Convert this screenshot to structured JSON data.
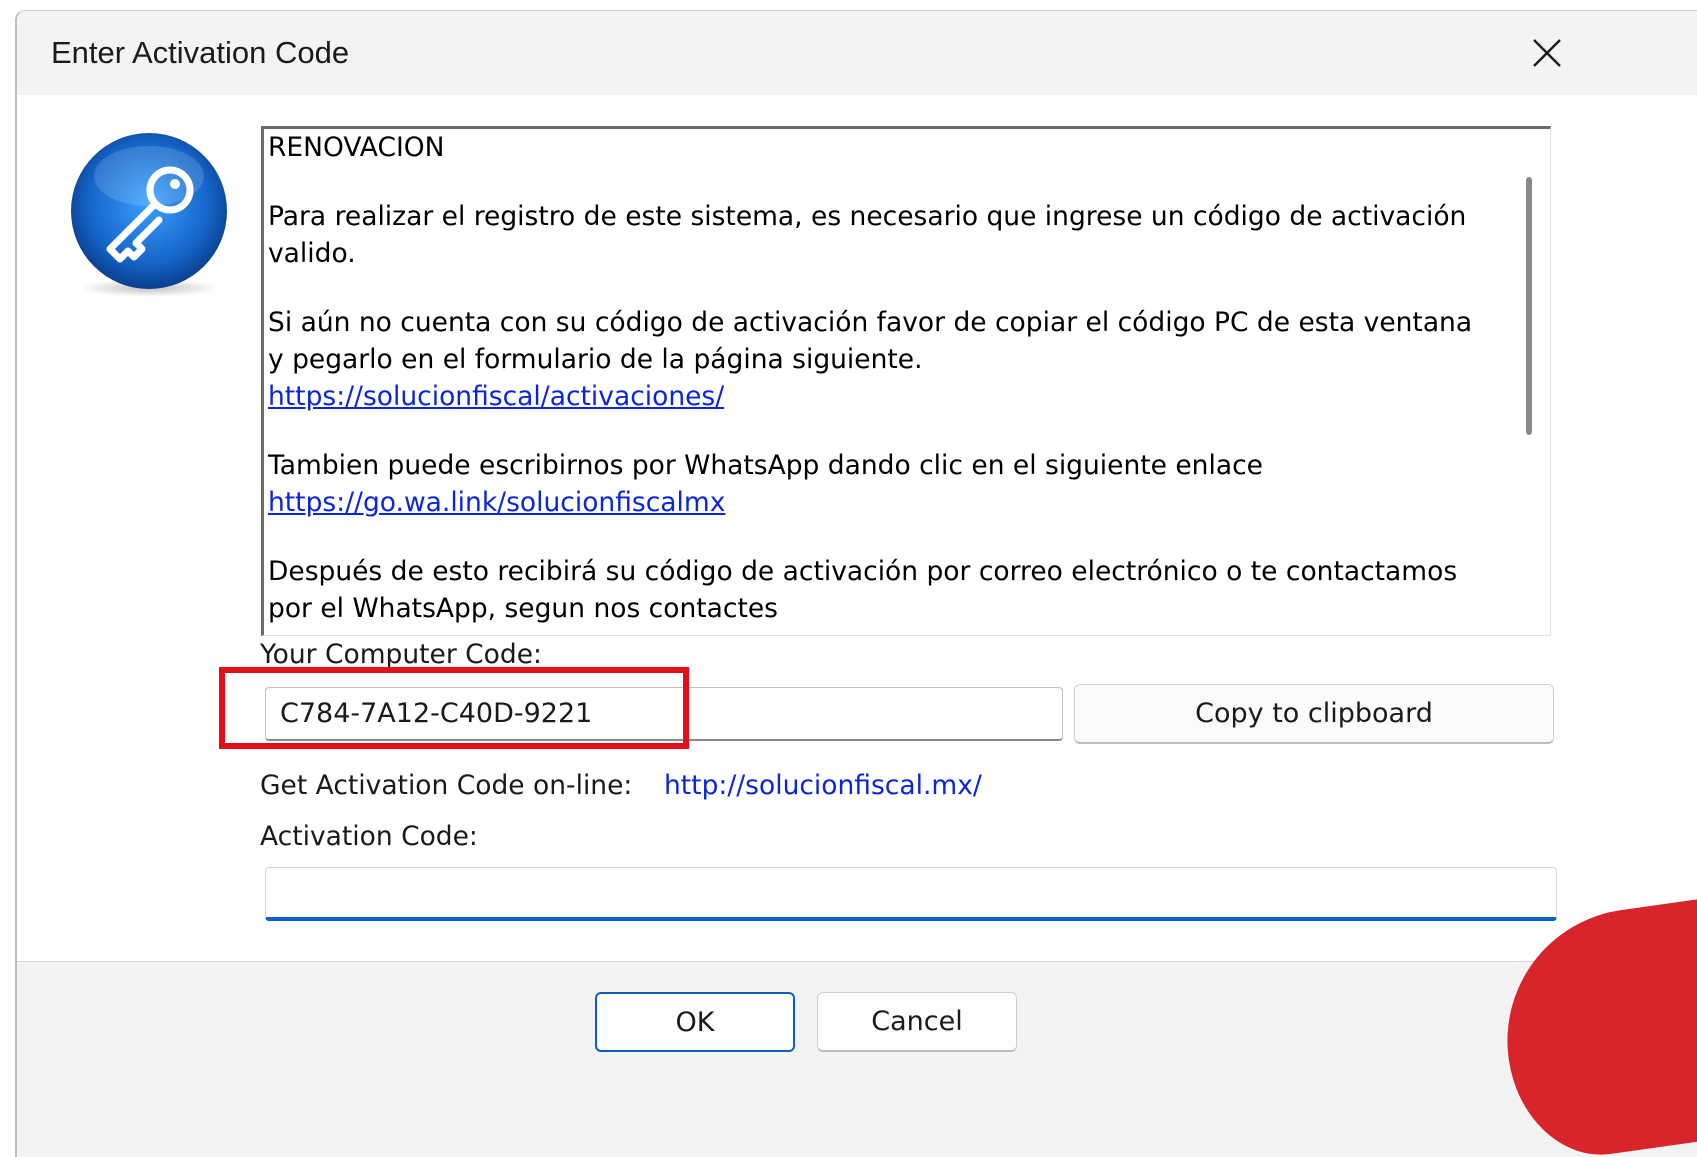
{
  "window": {
    "title": "Enter Activation Code",
    "close_icon": "close-icon"
  },
  "icon": {
    "name": "key-icon",
    "color": "#1565c8"
  },
  "message": {
    "heading": "RENOVACION",
    "para1": "Para realizar el registro de este sistema, es necesario que ingrese un código de activación valido.",
    "para2": "Si aún no cuenta con su código de activación favor de copiar el código PC de esta ventana y pegarlo en el formulario de la página siguiente.",
    "link1": "https://solucionfiscal/activaciones/",
    "para3": "Tambien puede escribirnos por WhatsApp dando clic en el siguiente enlace",
    "link2": "https://go.wa.link/solucionfiscalmx",
    "para4": "Después de esto recibirá su código de activación por correo electrónico o te contactamos por el WhatsApp, segun nos contactes"
  },
  "computer_code": {
    "label": "Your Computer Code:",
    "value": "C784-7A12-C40D-9221",
    "copy_button": "Copy to clipboard",
    "highlight_color": "#e10f17"
  },
  "online": {
    "label": "Get Activation Code on-line:",
    "link": "http://solucionfiscal.mx/"
  },
  "activation": {
    "label": "Activation Code:",
    "value": ""
  },
  "buttons": {
    "ok": "OK",
    "cancel": "Cancel"
  },
  "colors": {
    "link": "#0b26d9",
    "accent": "#0a63c9",
    "highlight": "#e10f17"
  }
}
